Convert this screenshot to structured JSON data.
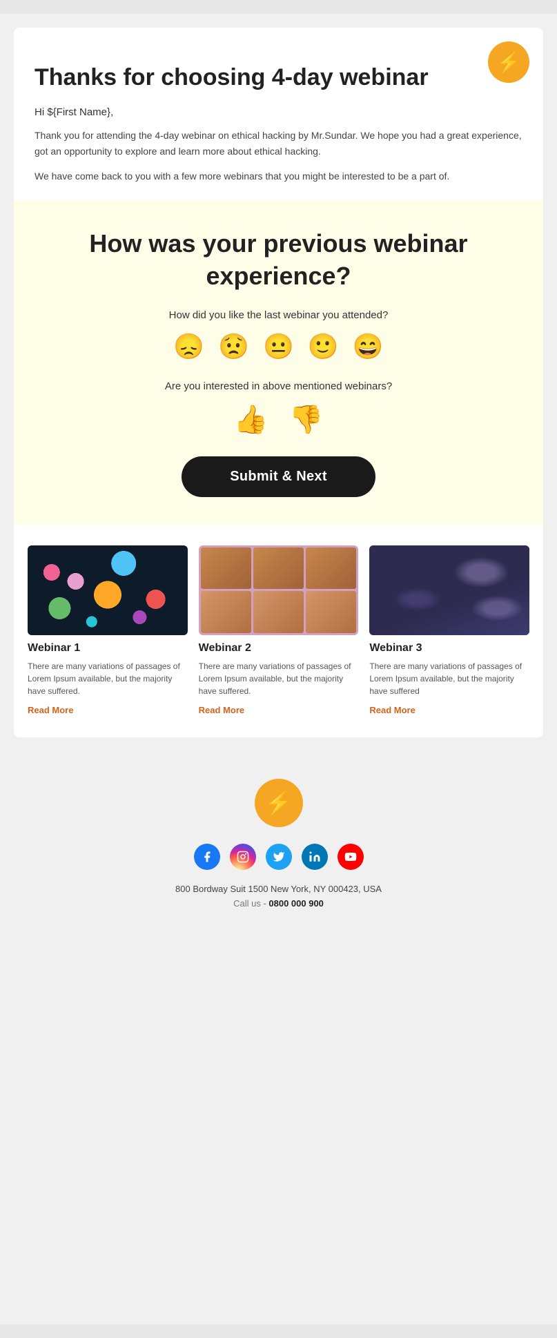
{
  "logo": {
    "icon": "⚡"
  },
  "header": {
    "title": "Thanks for choosing 4-day webinar",
    "greeting": "Hi ${First Name},",
    "body1": "Thank you for attending the 4-day webinar on ethical hacking by Mr.Sundar. We hope you had a great experience, got an opportunity to explore and learn more about ethical hacking.",
    "body2": "We have come back to you with a few more webinars that you might be interested to be a part of."
  },
  "survey": {
    "title": "How was your previous webinar experience?",
    "question1": "How did you like the last webinar you attended?",
    "emojis": [
      "😞",
      "😟",
      "😐",
      "🙂",
      "😄"
    ],
    "question2": "Are you interested in above mentioned webinars?",
    "thumbs_up": "👍",
    "thumbs_down": "👎",
    "submit_label": "Submit & Next"
  },
  "webinars": [
    {
      "name": "Webinar 1",
      "description": "There are many variations of passages of Lorem Ipsum available, but the majority have suffered.",
      "read_more": "Read More"
    },
    {
      "name": "Webinar 2",
      "description": "There are many variations of passages of Lorem Ipsum available, but the majority have suffered.",
      "read_more": "Read More"
    },
    {
      "name": "Webinar 3",
      "description": "There are many variations of passages of Lorem Ipsum available, but the majority have suffered",
      "read_more": "Read More"
    }
  ],
  "footer": {
    "logo_icon": "⚡",
    "social": [
      {
        "name": "facebook",
        "icon": "f",
        "class": "social-facebook"
      },
      {
        "name": "instagram",
        "icon": "📷",
        "class": "social-instagram"
      },
      {
        "name": "twitter",
        "icon": "🐦",
        "class": "social-twitter"
      },
      {
        "name": "linkedin",
        "icon": "in",
        "class": "social-linkedin"
      },
      {
        "name": "youtube",
        "icon": "▶",
        "class": "social-youtube"
      }
    ],
    "address": "800 Bordway Suit 1500 New York, NY 000423, USA",
    "call_label": "Call us - ",
    "phone": "0800 000 900"
  }
}
